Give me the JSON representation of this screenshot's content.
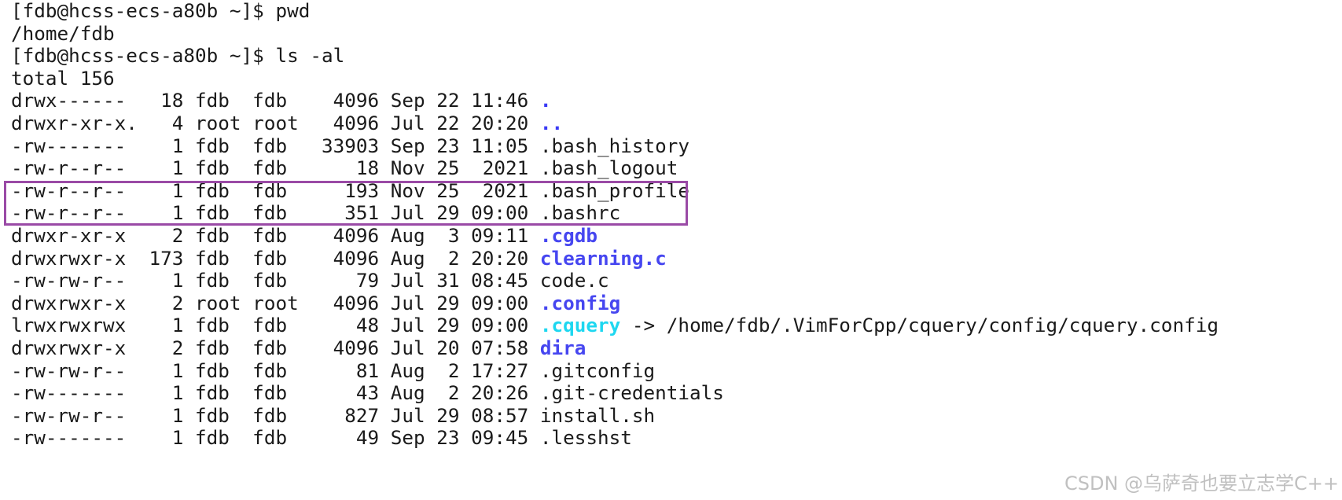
{
  "terminal": {
    "lines": [
      {
        "prefix": "[fdb@hcss-ecs-a80b ~]$ pwd",
        "name": "",
        "style": "",
        "suffix": ""
      },
      {
        "prefix": "/home/fdb",
        "name": "",
        "style": "",
        "suffix": ""
      },
      {
        "prefix": "[fdb@hcss-ecs-a80b ~]$ ls -al",
        "name": "",
        "style": "",
        "suffix": ""
      },
      {
        "prefix": "total 156",
        "name": "",
        "style": "",
        "suffix": ""
      },
      {
        "prefix": "drwx------   18 fdb  fdb    4096 Sep 22 11:46 ",
        "name": ".",
        "style": "dot",
        "suffix": ""
      },
      {
        "prefix": "drwxr-xr-x.   4 root root   4096 Jul 22 20:20 ",
        "name": "..",
        "style": "dot",
        "suffix": ""
      },
      {
        "prefix": "-rw-------    1 fdb  fdb   33903 Sep 23 11:05 ",
        "name": ".bash_history",
        "style": "",
        "suffix": ""
      },
      {
        "prefix": "-rw-r--r--    1 fdb  fdb      18 Nov 25  2021 ",
        "name": ".bash_logout",
        "style": "",
        "suffix": ""
      },
      {
        "prefix": "-rw-r--r--    1 fdb  fdb     193 Nov 25  2021 ",
        "name": ".bash_profile",
        "style": "",
        "suffix": ""
      },
      {
        "prefix": "-rw-r--r--    1 fdb  fdb     351 Jul 29 09:00 ",
        "name": ".bashrc",
        "style": "",
        "suffix": ""
      },
      {
        "prefix": "drwxr-xr-x    2 fdb  fdb    4096 Aug  3 09:11 ",
        "name": ".cgdb",
        "style": "dir",
        "suffix": ""
      },
      {
        "prefix": "drwxrwxr-x  173 fdb  fdb    4096 Aug  2 20:20 ",
        "name": "clearning.c",
        "style": "dir",
        "suffix": ""
      },
      {
        "prefix": "-rw-rw-r--    1 fdb  fdb      79 Jul 31 08:45 ",
        "name": "code.c",
        "style": "",
        "suffix": ""
      },
      {
        "prefix": "drwxrwxr-x    2 root root   4096 Jul 29 09:00 ",
        "name": ".config",
        "style": "dir",
        "suffix": ""
      },
      {
        "prefix": "lrwxrwxrwx    1 fdb  fdb      48 Jul 29 09:00 ",
        "name": ".cquery",
        "style": "link",
        "suffix": " -> /home/fdb/.VimForCpp/cquery/config/cquery.config"
      },
      {
        "prefix": "drwxrwxr-x    2 fdb  fdb    4096 Jul 20 07:58 ",
        "name": "dira",
        "style": "dir",
        "suffix": ""
      },
      {
        "prefix": "-rw-rw-r--    1 fdb  fdb      81 Aug  2 17:27 ",
        "name": ".gitconfig",
        "style": "",
        "suffix": ""
      },
      {
        "prefix": "-rw-------    1 fdb  fdb      43 Aug  2 20:26 ",
        "name": ".git-credentials",
        "style": "",
        "suffix": ""
      },
      {
        "prefix": "-rw-rw-r--    1 fdb  fdb     827 Jul 29 08:57 ",
        "name": "install.sh",
        "style": "",
        "suffix": ""
      },
      {
        "prefix": "-rw-------    1 fdb  fdb      49 Sep 23 09:45 ",
        "name": ".lesshst",
        "style": "",
        "suffix": ""
      }
    ]
  },
  "watermark": "CSDN @乌萨奇也要立志学C++",
  "colors": {
    "directory": "#4646f0",
    "symlink": "#1ed7f0",
    "highlight_box": "#9a4aa6"
  }
}
